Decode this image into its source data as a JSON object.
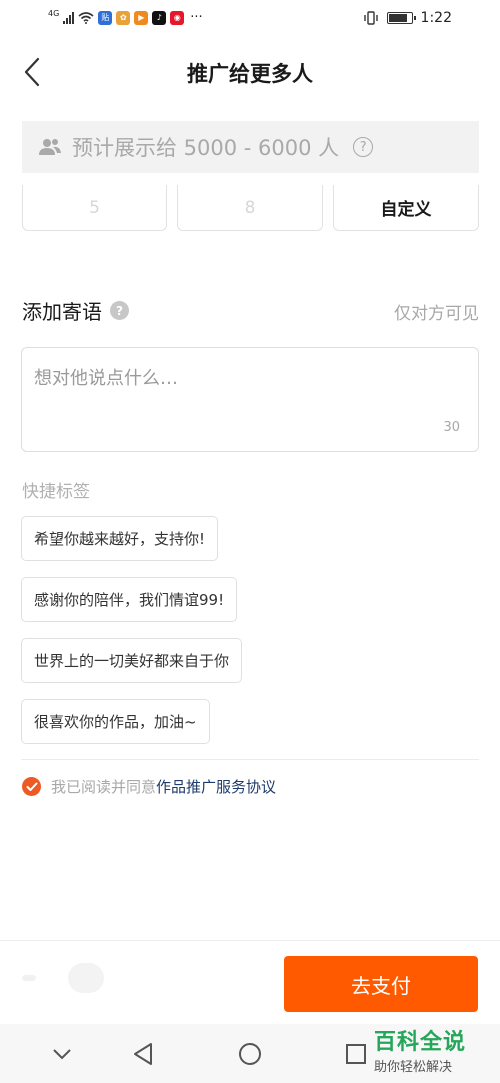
{
  "status_bar": {
    "network": "4G",
    "more": "···",
    "time": "1:22",
    "app_icons": [
      {
        "name": "tieba-icon",
        "glyph": "贴",
        "color": "#2f6fd6"
      },
      {
        "name": "baidu-paw-icon",
        "glyph": "✿",
        "color": "#e8a23a"
      },
      {
        "name": "video-play-icon",
        "glyph": "▶",
        "color": "#f08a1c"
      },
      {
        "name": "tiktok-icon",
        "glyph": "♪",
        "color": "#111111"
      },
      {
        "name": "weibo-icon",
        "glyph": "◉",
        "color": "#e6162d"
      }
    ]
  },
  "header": {
    "title": "推广给更多人"
  },
  "estimate": {
    "text": "预计展示给 5000 - 6000 人",
    "help": "?"
  },
  "options": [
    {
      "label": "5",
      "state": "faded"
    },
    {
      "label": "8",
      "state": "faded"
    },
    {
      "label": "自定义",
      "state": "normal"
    }
  ],
  "message": {
    "title": "添加寄语",
    "help": "?",
    "visibility": "仅对方可见",
    "placeholder": "想对他说点什么…",
    "limit": "30"
  },
  "quick_tags": {
    "title": "快捷标签",
    "items": [
      "希望你越来越好，支持你!",
      "感谢你的陪伴，我们情谊99!",
      "世界上的一切美好都来自于你",
      "很喜欢你的作品，加油~"
    ]
  },
  "agreement": {
    "checked": true,
    "prefix": "我已阅读并同意",
    "link": "作品推广服务协议"
  },
  "footer": {
    "pay_label": "去支付"
  },
  "watermark": {
    "title": "百科全说",
    "subtitle": "助你轻松解决"
  },
  "colors": {
    "accent": "#ff5a00",
    "check": "#ee5a24",
    "link": "#1d3b6c",
    "watermark": "#26a65b"
  }
}
